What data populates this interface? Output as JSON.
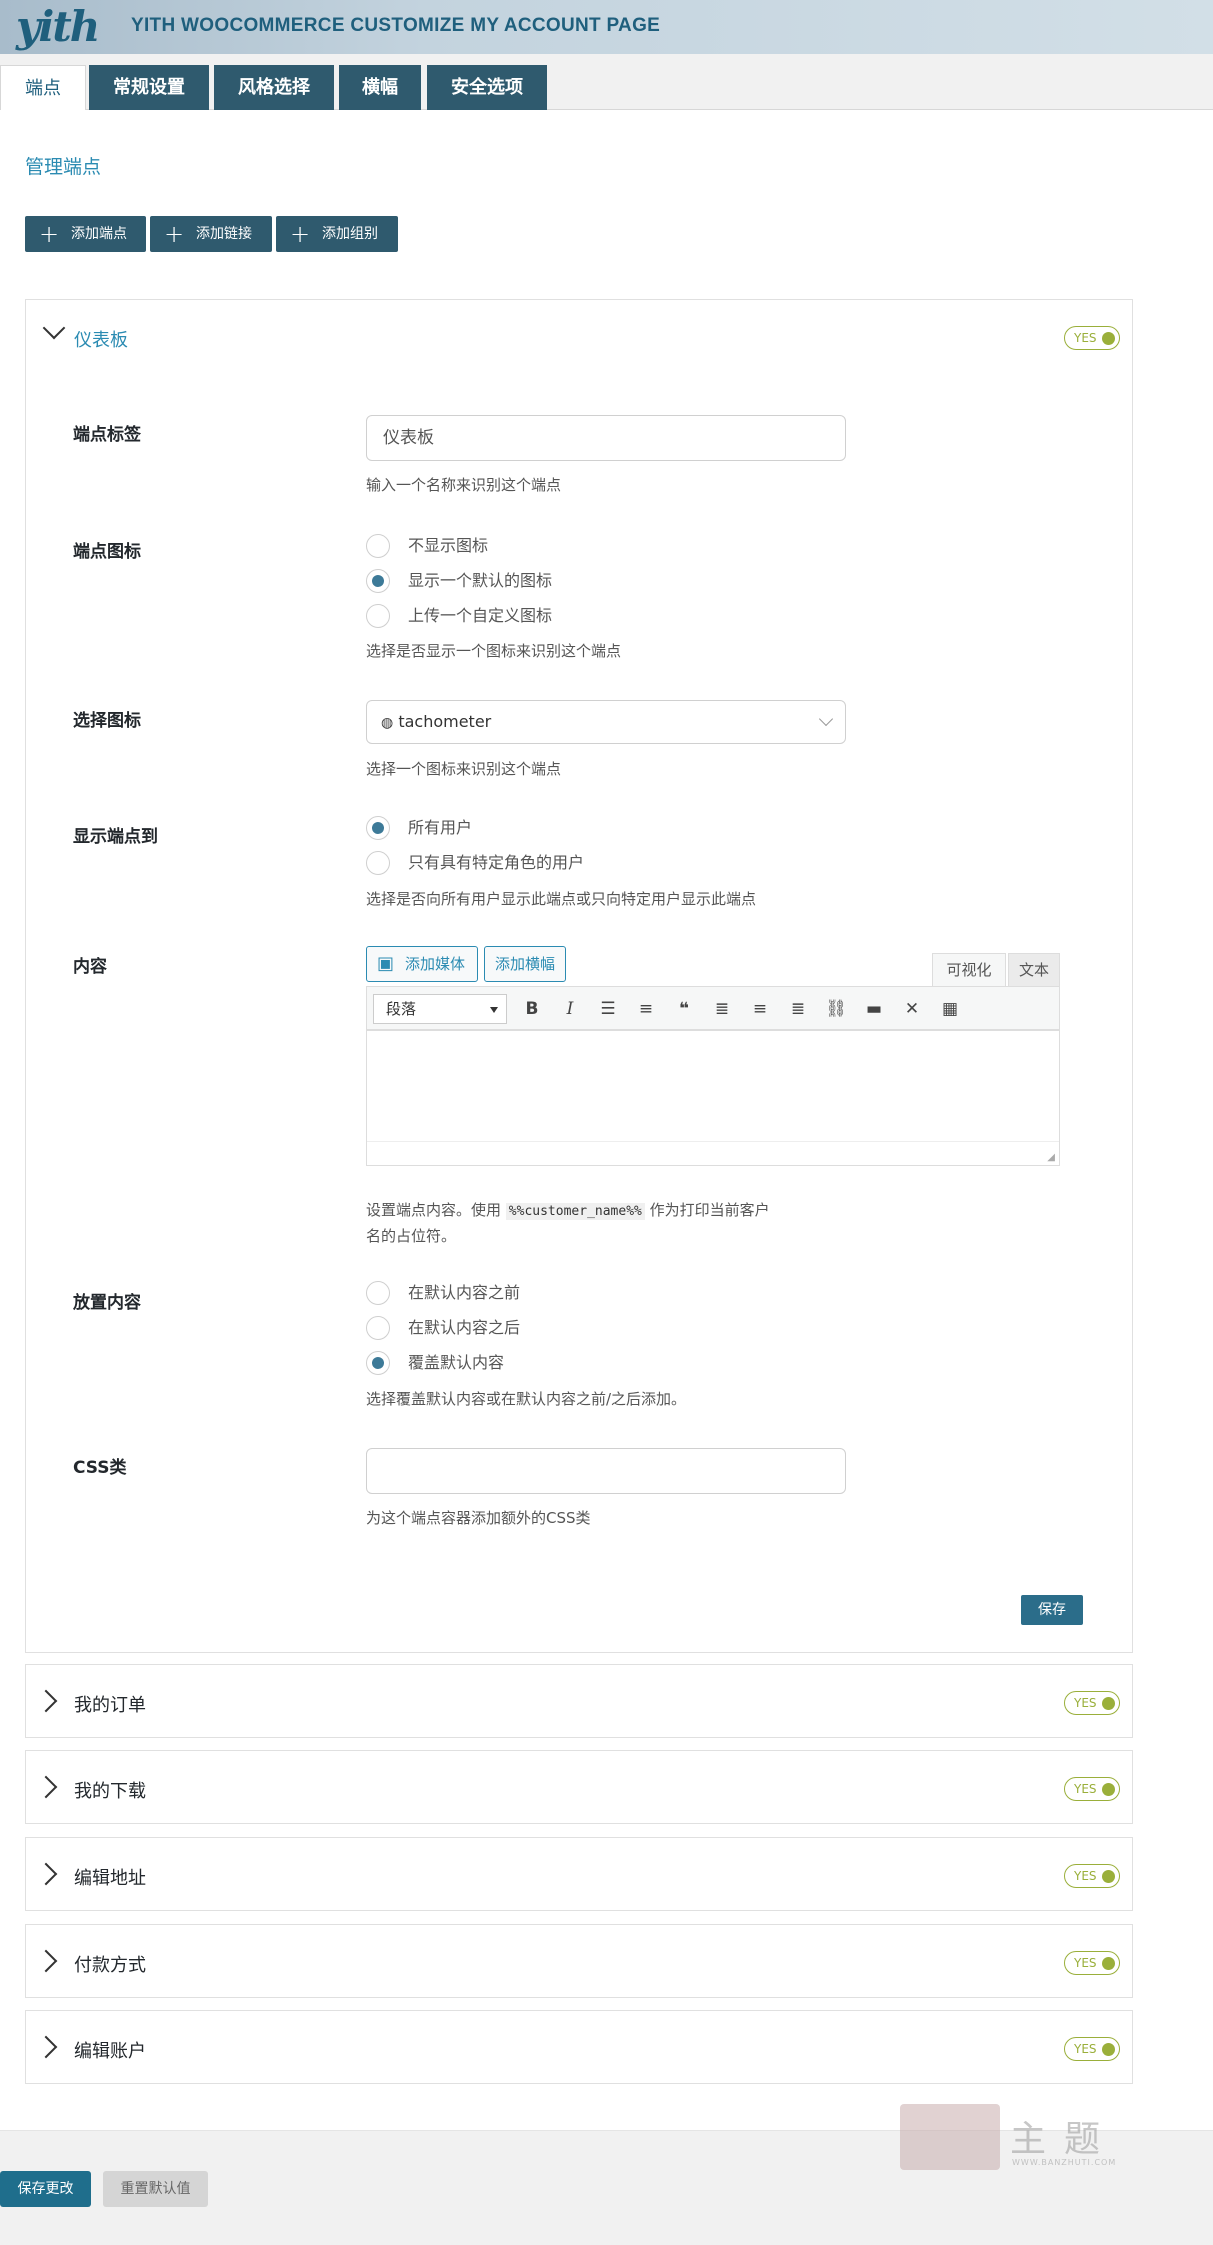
{
  "header": {
    "logo": "yith",
    "title": "YITH WOOCOMMERCE CUSTOMIZE MY ACCOUNT PAGE"
  },
  "tabs": [
    {
      "label": "端点",
      "active": true
    },
    {
      "label": "常规设置"
    },
    {
      "label": "风格选择"
    },
    {
      "label": "横幅"
    },
    {
      "label": "安全选项"
    }
  ],
  "page_title": "管理端点",
  "add_buttons": [
    "添加端点",
    "添加链接",
    "添加组别"
  ],
  "toggle_label": "YES",
  "dashboard": {
    "title": "仪表板",
    "label_field": {
      "label": "端点标签",
      "value": "仪表板",
      "desc": "输入一个名称来识别这个端点"
    },
    "icon_field": {
      "label": "端点图标",
      "options": [
        "不显示图标",
        "显示一个默认的图标",
        "上传一个自定义图标"
      ],
      "selected_index": 1,
      "desc": "选择是否显示一个图标来识别这个端点"
    },
    "select_icon": {
      "label": "选择图标",
      "icon": "tachometer-icon",
      "value": "tachometer",
      "desc": "选择一个图标来识别这个端点"
    },
    "visibility": {
      "label": "显示端点到",
      "options": [
        "所有用户",
        "只有具有特定角色的用户"
      ],
      "selected_index": 0,
      "desc": "选择是否向所有用户显示此端点或只向特定用户显示此端点"
    },
    "content": {
      "label": "内容",
      "add_media": "添加媒体",
      "add_banner": "添加横幅",
      "tab_visual": "可视化",
      "tab_text": "文本",
      "format": "段落",
      "desc_before": "设置端点内容。使用",
      "desc_token": "%%customer_name%%",
      "desc_after": "作为打印当前客户",
      "desc_line2": "名的占位符。"
    },
    "placement": {
      "label": "放置内容",
      "options": [
        "在默认内容之前",
        "在默认内容之后",
        "覆盖默认内容"
      ],
      "selected_index": 2,
      "desc": "选择覆盖默认内容或在默认内容之前/之后添加。"
    },
    "css_class": {
      "label": "CSS类",
      "value": "",
      "desc": "为这个端点容器添加额外的CSS类"
    },
    "save_label": "保存"
  },
  "collapsed_panels": [
    "我的订单",
    "我的下载",
    "编辑地址",
    "付款方式",
    "编辑账户"
  ],
  "footer": {
    "save_changes": "保存更改",
    "reset_defaults": "重置默认值"
  },
  "watermark": {
    "text": "主题",
    "url": "WWW.BANZHUTI.COM"
  }
}
